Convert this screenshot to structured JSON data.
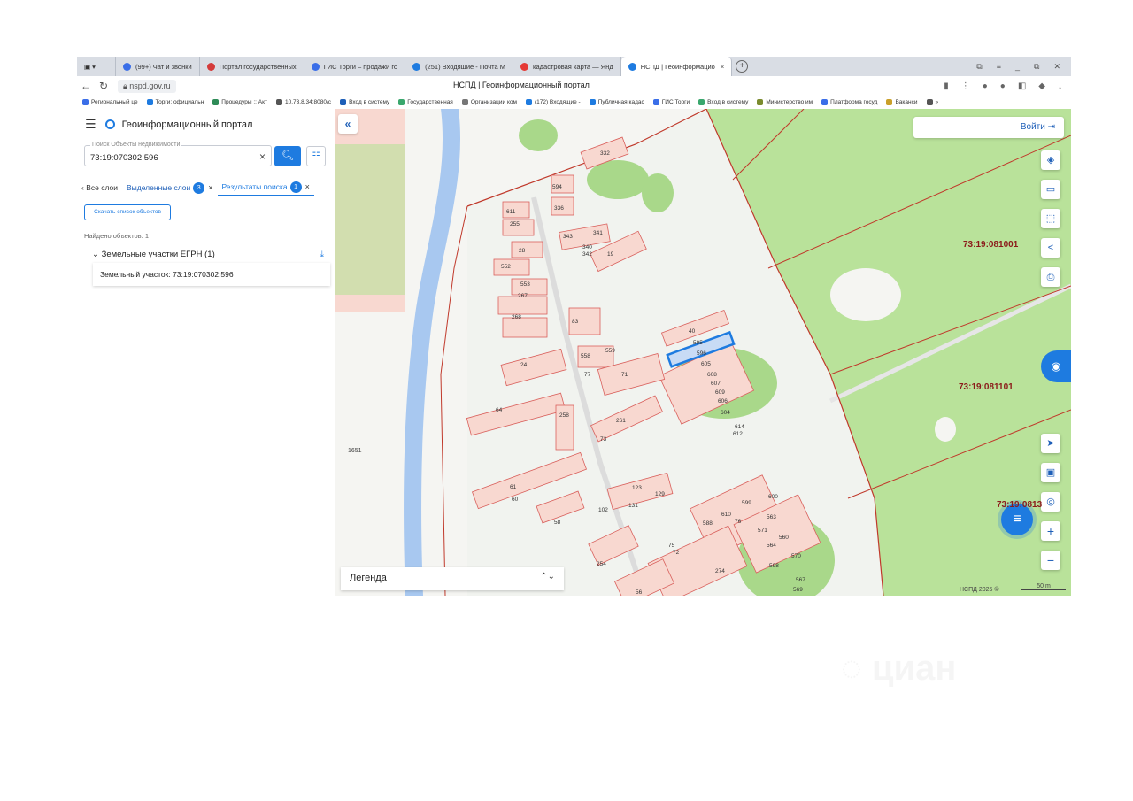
{
  "browser": {
    "tabs": [
      {
        "label": "(99+) Чат и звонки",
        "color": "#3a6ee8"
      },
      {
        "label": "Портал государственных",
        "color": "#d43b3b"
      },
      {
        "label": "ГИС Торги – продажи го",
        "color": "#3a6ee8"
      },
      {
        "label": "(251) Входящие - Почта М",
        "color": "#1e7be0"
      },
      {
        "label": "кадастровая карта — Янд",
        "color": "#e53935"
      },
      {
        "label": "НСПД | Геоинформацио",
        "color": "#1e7be0",
        "active": true
      }
    ],
    "tab_close": "×",
    "new_tab": "+",
    "window_buttons": [
      "⧉",
      "≡",
      "_",
      "⧉",
      "✕"
    ],
    "url": "nspd.gov.ru",
    "page_title": "НСПД | Геоинформационный портал",
    "bookmarks": [
      "Региональный це",
      "Торги: официальн",
      "Процедуры :: Акт",
      "10.73.8.34:8080/c",
      "Вход в систему",
      "Государственная",
      "Организации ком",
      "(172) Входящие -",
      "Публичная кадас",
      "ГИС Торги",
      "Вход в систему",
      "Министерство им",
      "Платформа госуд",
      "Ваканси",
      "»"
    ]
  },
  "sidebar": {
    "app_title": "Геоинформационный портал",
    "search_label": "Поиск Объекты недвижимости",
    "search_value": "73:19:070302:596",
    "clear_icon": "×",
    "tabs": [
      {
        "label": "Все слои"
      },
      {
        "label": "Выделенные слои",
        "count": "3"
      },
      {
        "label": "Результаты поиска",
        "count": "1"
      }
    ],
    "download_list": "Скачать список объектов",
    "found": "Найдено объектов: 1",
    "group_label": "Земельные участки ЕГРН (1)",
    "result_item": "Земельный участок: 73:19:070302:596"
  },
  "map": {
    "login": "Войти",
    "legend": "Легенда",
    "copyright": "НСПД 2025 ©",
    "scale": "50 m",
    "zones": [
      "73:19:081001",
      "73:19:081101",
      "73:19:0813"
    ],
    "edge_number": "1651",
    "parcel_labels": [
      "332",
      "594",
      "336",
      "611",
      "255",
      "343",
      "341",
      "340",
      "342",
      "19",
      "28",
      "552",
      "553",
      "267",
      "268",
      "83",
      "40",
      "595",
      "596",
      "605",
      "608",
      "607",
      "609",
      "606",
      "604",
      "614",
      "612",
      "24",
      "558",
      "559",
      "71",
      "77",
      "64",
      "258",
      "261",
      "73",
      "61",
      "60",
      "58",
      "102",
      "123",
      "129",
      "131",
      "588",
      "610",
      "76",
      "599",
      "600",
      "563",
      "571",
      "560",
      "564",
      "570",
      "598",
      "567",
      "569",
      "254",
      "274",
      "56",
      "75",
      "72"
    ],
    "colors": {
      "parcel_fill": "#f8d8d0",
      "parcel_stroke": "#d9605c",
      "forest": "#b9e29a",
      "river": "#a8c8f0",
      "selected": "#1e7be0",
      "zone_line": "#c0392b"
    }
  }
}
